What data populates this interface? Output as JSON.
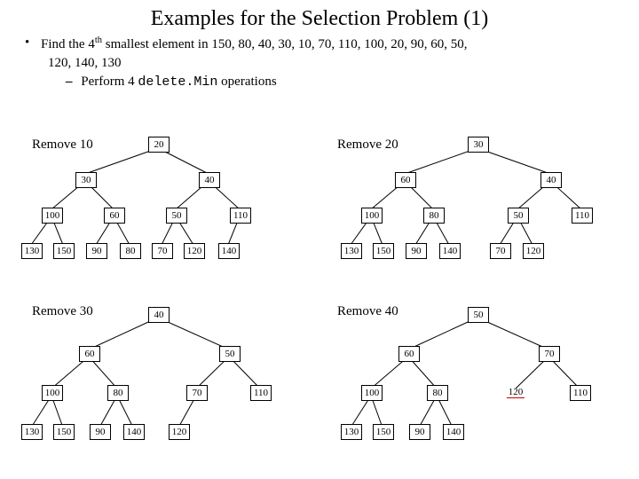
{
  "title": "Examples for the Selection Problem (1)",
  "bullet": {
    "line1_prefix": "Find the 4",
    "line1_sup": "th",
    "line1_rest": " smallest element in 150, 80, 40, 30, 10, 70, 110, 100, 20, 90, 60, 50,",
    "line2": "120, 140, 130",
    "sub_prefix": "Perform 4 ",
    "sub_mono": "delete.Min",
    "sub_rest": " operations"
  },
  "tree1": {
    "label": "Remove 10",
    "root": "20",
    "l2": [
      "30",
      "40"
    ],
    "l3": [
      "100",
      "60",
      "50",
      "110"
    ],
    "l4": [
      "130",
      "150",
      "90",
      "80",
      "70",
      "120",
      "140"
    ]
  },
  "tree2": {
    "label": "Remove 20",
    "root": "30",
    "l2": [
      "60",
      "40"
    ],
    "l3": [
      "100",
      "80",
      "50",
      "110"
    ],
    "l4": [
      "130",
      "150",
      "90",
      "140",
      "70",
      "120"
    ]
  },
  "tree3": {
    "label": "Remove 30",
    "root": "40",
    "l2": [
      "60",
      "50"
    ],
    "l3": [
      "100",
      "80",
      "70",
      "110"
    ],
    "l4": [
      "130",
      "150",
      "90",
      "140",
      "120"
    ]
  },
  "tree4": {
    "label": "Remove 40",
    "root": "50",
    "l2": [
      "60",
      "70"
    ],
    "l3": [
      "100",
      "80",
      "120",
      "110"
    ],
    "l4": [
      "130",
      "150",
      "90",
      "140"
    ],
    "red_index": 2
  }
}
